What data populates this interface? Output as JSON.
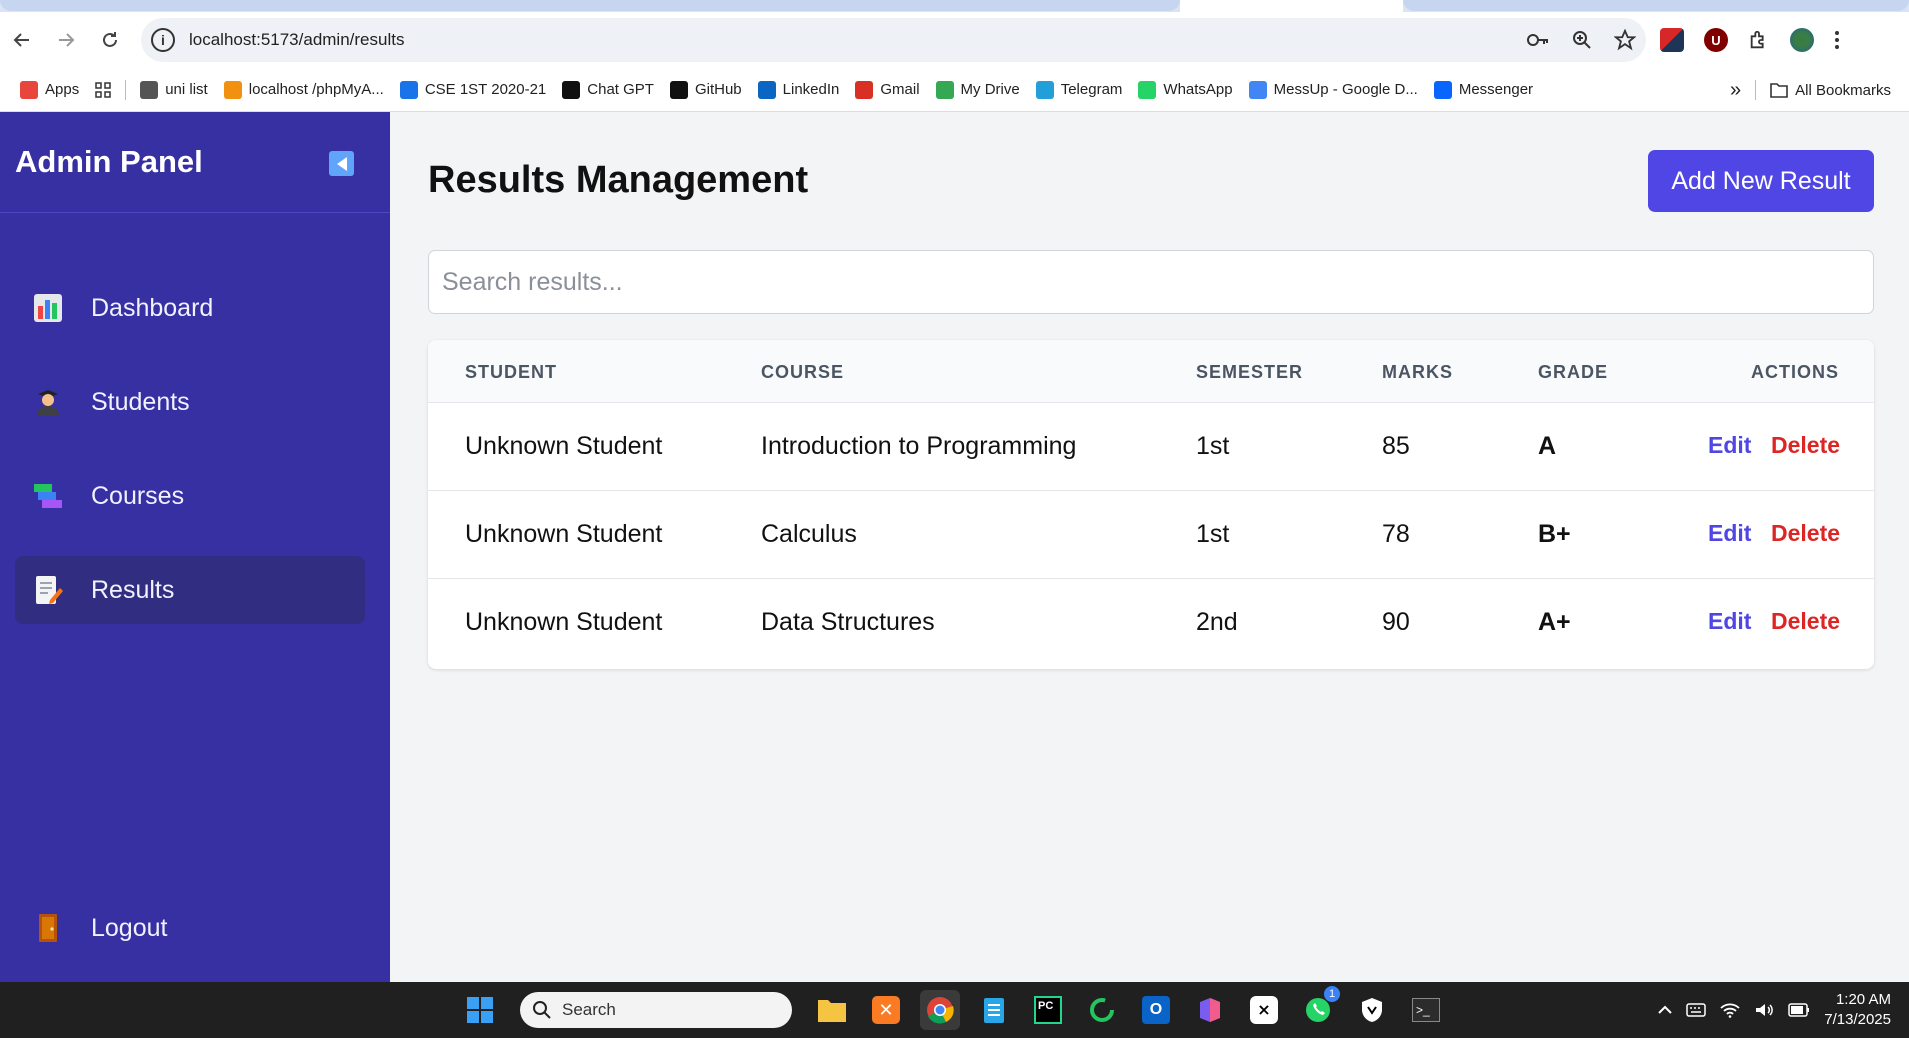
{
  "browser": {
    "url": "localhost:5173/admin/results",
    "bookmarks": [
      {
        "label": "Apps",
        "color": "#e8453c"
      },
      {
        "label": "uni list",
        "color": "#555555"
      },
      {
        "label": "localhost /phpMyA...",
        "color": "#f29111"
      },
      {
        "label": "CSE 1ST 2020-21",
        "color": "#1a73e8"
      },
      {
        "label": "Chat GPT",
        "color": "#111111"
      },
      {
        "label": "GitHub",
        "color": "#111111"
      },
      {
        "label": "LinkedIn",
        "color": "#0a66c2"
      },
      {
        "label": "Gmail",
        "color": "#d93025"
      },
      {
        "label": "My Drive",
        "color": "#34a853"
      },
      {
        "label": "Telegram",
        "color": "#229ed9"
      },
      {
        "label": "WhatsApp",
        "color": "#25d366"
      },
      {
        "label": "MessUp - Google D...",
        "color": "#4285f4"
      },
      {
        "label": "Messenger",
        "color": "#0866ff"
      }
    ],
    "more_bookmarks": "»",
    "all_bookmarks": "All Bookmarks"
  },
  "sidebar": {
    "title": "Admin Panel",
    "items": [
      {
        "label": "Dashboard",
        "icon": "bar-chart-icon",
        "active": false
      },
      {
        "label": "Students",
        "icon": "student-icon",
        "active": false
      },
      {
        "label": "Courses",
        "icon": "books-icon",
        "active": false
      },
      {
        "label": "Results",
        "icon": "memo-icon",
        "active": true
      }
    ],
    "logout": "Logout"
  },
  "main": {
    "title": "Results Management",
    "add_button": "Add New Result",
    "search_placeholder": "Search results...",
    "columns": [
      "STUDENT",
      "COURSE",
      "SEMESTER",
      "MARKS",
      "GRADE",
      "ACTIONS"
    ],
    "rows": [
      {
        "student": "Unknown Student",
        "course": "Introduction to Programming",
        "semester": "1st",
        "marks": "85",
        "grade": "A"
      },
      {
        "student": "Unknown Student",
        "course": "Calculus",
        "semester": "1st",
        "marks": "78",
        "grade": "B+"
      },
      {
        "student": "Unknown Student",
        "course": "Data Structures",
        "semester": "2nd",
        "marks": "90",
        "grade": "A+"
      }
    ],
    "edit_label": "Edit",
    "delete_label": "Delete"
  },
  "taskbar": {
    "search_label": "Search",
    "time": "1:20 AM",
    "date": "7/13/2025",
    "whatsapp_badge": "1"
  },
  "colors": {
    "sidebar": "#3730a3",
    "sidebar_active": "#312e81",
    "primary": "#4f46e5",
    "danger": "#dc2626"
  }
}
